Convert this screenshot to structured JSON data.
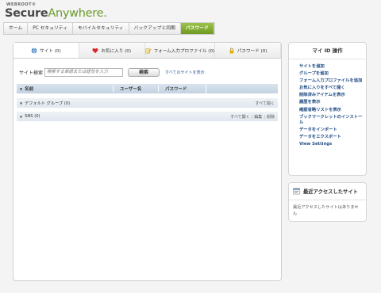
{
  "brand": {
    "small": "WEBROOT®",
    "secure": "Secure",
    "anywhere": "Anywhere."
  },
  "nav": [
    "ホーム",
    "PC セキュリティ",
    "モバイルセキュリティ",
    "バックアップと同期",
    "パスワード"
  ],
  "tabs": [
    "サイト (0)",
    "お気に入り (0)",
    "フォーム入力プロファイル (0)",
    "パスワード (0)"
  ],
  "search": {
    "label": "サイト検索",
    "placeholder": "検索する単語または語句を入力",
    "button": "検索",
    "show_all": "すべてのサイトを表示"
  },
  "table": {
    "columns": [
      "名前",
      "ユーザー名",
      "パスワード"
    ]
  },
  "groups": [
    {
      "name": "デフォルト グループ (0)",
      "open_all": "すべて開く"
    },
    {
      "name": "SNS (0)",
      "open_all": "すべて開く",
      "edit": "編集",
      "delete": "削除"
    }
  ],
  "sidebar": {
    "title": "マイ ID 操作",
    "links": [
      "サイトを追加",
      "グループを追加",
      "フォーム入力プロファイルを追加",
      "お気に入りをすべて開く",
      "削除済みアイテムを表示",
      "履歴を表示",
      "確認省略リストを表示",
      "ブックマークレットのインストール",
      "データをインポート",
      "データをエクスポート",
      "View Settings"
    ]
  },
  "recent": {
    "title": "最近アクセスしたサイト",
    "empty": "最近アクセスしたサイトはありません"
  },
  "colors": {
    "accent_green": "#6e9a22",
    "link_blue": "#1e4a82"
  }
}
